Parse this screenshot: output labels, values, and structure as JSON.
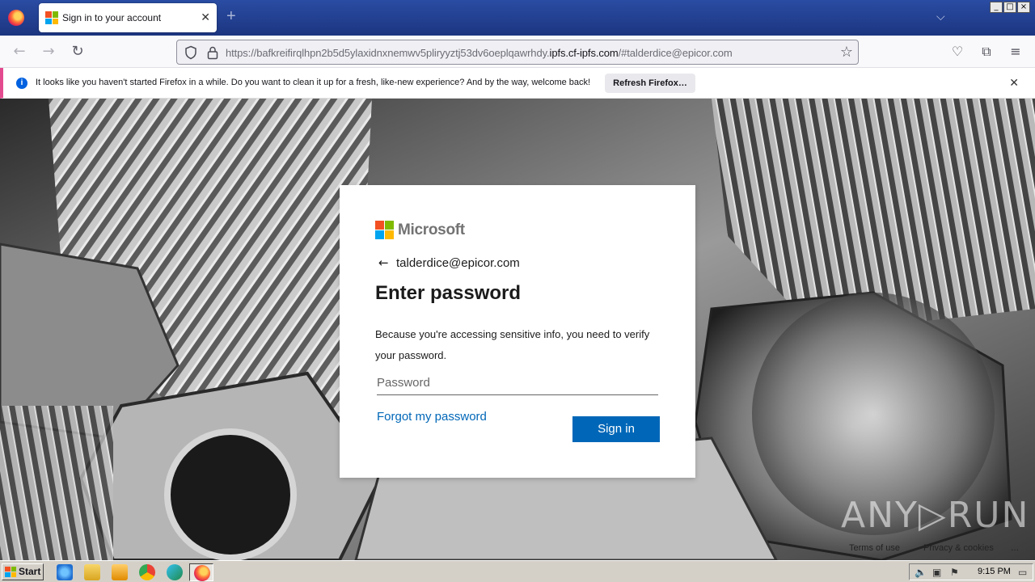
{
  "browser": {
    "tab_title": "Sign in to your account",
    "url_prefix": "https://bafkreifirqlhpn2b5d5ylaxidnxnemwv5pliryyztj53dv6oeplqawrhdy.",
    "url_host": "ipfs.cf-ipfs.com",
    "url_suffix": "/#talderdice@epicor.com",
    "window_controls": [
      "_",
      "□",
      "×"
    ]
  },
  "notification": {
    "message": "It looks like you haven't started Firefox in a while. Do you want to clean it up for a fresh, like-new experience? And by the way, welcome back!",
    "button_label": "Refresh Firefox…"
  },
  "signin": {
    "brand": "Microsoft",
    "identity": "talderdice@epicor.com",
    "heading": "Enter password",
    "description": "Because you're accessing sensitive info, you need to verify your password.",
    "password_placeholder": "Password",
    "forgot_label": "Forgot my password",
    "submit_label": "Sign in"
  },
  "page_footer": {
    "watermark": "ANY▷RUN",
    "links": [
      "Terms of use",
      "Privacy & cookies"
    ],
    "more": "..."
  },
  "taskbar": {
    "start_label": "Start",
    "clock": "9:15 PM"
  },
  "colors": {
    "ms_red": "#f25022",
    "ms_green": "#7fba00",
    "ms_blue": "#00a4ef",
    "ms_yellow": "#ffb900",
    "accent": "#0067b8"
  }
}
